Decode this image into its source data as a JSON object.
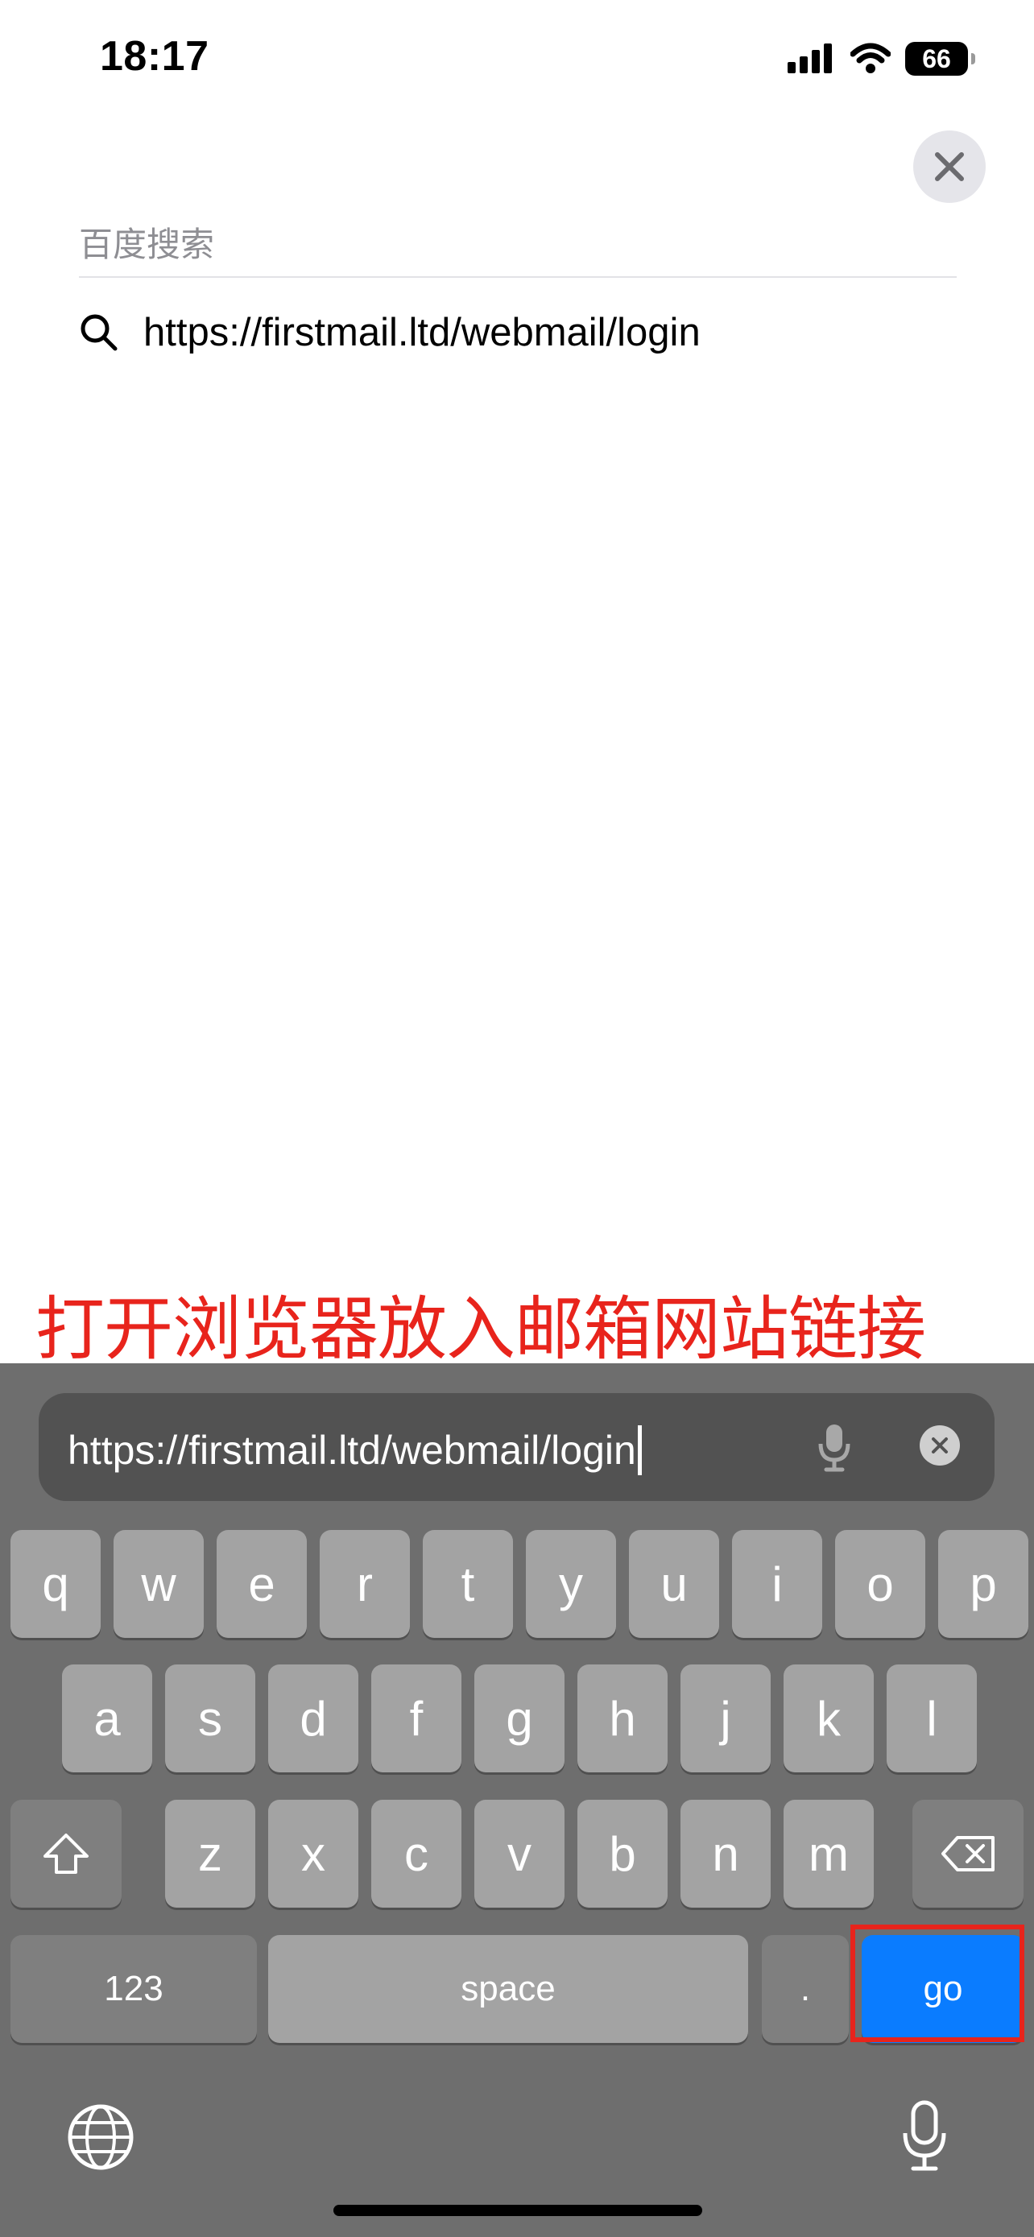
{
  "status_bar": {
    "time": "18:17",
    "battery_level": "66"
  },
  "search_panel": {
    "section_header": "百度搜索",
    "suggestion": "https://firstmail.ltd/webmail/login"
  },
  "annotation": "打开浏览器放入邮箱网站链接",
  "address_bar": {
    "value": "https://firstmail.ltd/webmail/login"
  },
  "keyboard": {
    "row1": [
      "q",
      "w",
      "e",
      "r",
      "t",
      "y",
      "u",
      "i",
      "o",
      "p"
    ],
    "row2": [
      "a",
      "s",
      "d",
      "f",
      "g",
      "h",
      "j",
      "k",
      "l"
    ],
    "row3": [
      "z",
      "x",
      "c",
      "v",
      "b",
      "n",
      "m"
    ],
    "numbers_label": "123",
    "space_label": "space",
    "period_label": ".",
    "go_label": "go"
  },
  "colors": {
    "go_key": "#0a7cff",
    "annotation_red": "#e8241c",
    "keyboard_bg": "#6e6e6e"
  }
}
